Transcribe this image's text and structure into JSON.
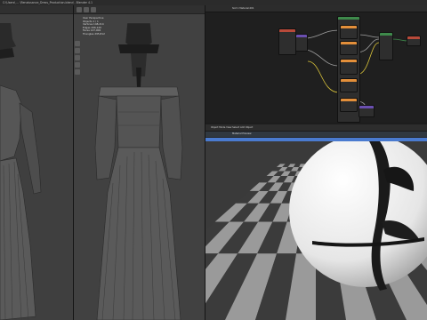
{
  "app": {
    "title": "C:\\Users\\ ... \\Renaissance_Dress_Production.blend - Blender 4.1"
  },
  "viewport_main": {
    "stats_title": "User Perspective",
    "stats_lines": [
      "Objects  1 / 1",
      "Vertices  148,214",
      "Edges  296,120",
      "Faces  147,906",
      "Triangles  295,812"
    ]
  },
  "node_editor": {
    "header": "Slot 1   Material.001"
  },
  "render_view": {
    "header": "Object Mode   View   Select   Add   Object",
    "subheader": "Material Preview"
  },
  "colors": {
    "accent_blue": "#4a7bd0",
    "node_orange": "#e38f3a",
    "node_green": "#3e8a4b",
    "node_red": "#b84a3a",
    "wire_gray": "#a0a0a0",
    "wire_yellow": "#d9c33a"
  },
  "icons": [
    "move-icon",
    "rotate-icon",
    "scale-icon",
    "cursor-icon",
    "measure-icon",
    "camera-icon",
    "render-icon"
  ]
}
